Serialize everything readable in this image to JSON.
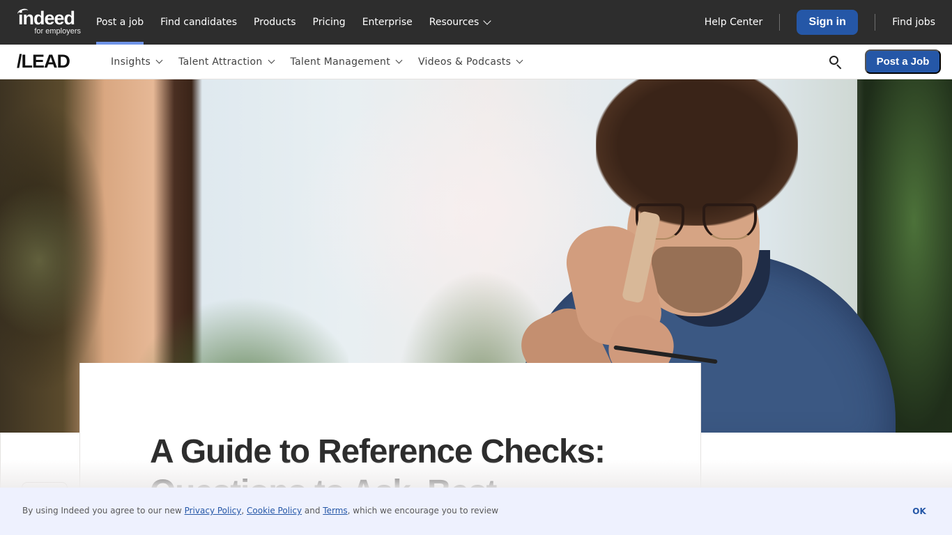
{
  "topbar": {
    "logo": {
      "wordmark": "indeed",
      "subtitle": "for employers"
    },
    "nav": [
      {
        "label": "Post a job",
        "active": true
      },
      {
        "label": "Find candidates"
      },
      {
        "label": "Products"
      },
      {
        "label": "Pricing"
      },
      {
        "label": "Enterprise"
      },
      {
        "label": "Resources",
        "has_dropdown": true
      }
    ],
    "help_center": "Help Center",
    "sign_in": "Sign in",
    "find_jobs": "Find jobs"
  },
  "subnav": {
    "logo": "/LEAD",
    "items": [
      {
        "label": "Insights"
      },
      {
        "label": "Talent Attraction"
      },
      {
        "label": "Talent Management"
      },
      {
        "label": "Videos & Podcasts"
      }
    ],
    "search_icon": "search-icon",
    "post_job": "Post a Job"
  },
  "hero": {
    "image_alt": "Man with curly hair and glasses talking on a phone"
  },
  "article": {
    "title": "A Guide to Reference Checks: Questions to Ask, Best"
  },
  "cookie_banner": {
    "prefix": "By using Indeed you agree to our new ",
    "privacy_policy": "Privacy Policy",
    "sep1": ", ",
    "cookie_policy": "Cookie Policy",
    "sep2": " and ",
    "terms": "Terms",
    "suffix": ", which we encourage you to review",
    "ok": "OK"
  },
  "colors": {
    "topbar_bg": "#2d2d2d",
    "brand_blue": "#2557a7",
    "active_underline": "#6f94e8",
    "cookie_bg": "#eef1fe"
  }
}
